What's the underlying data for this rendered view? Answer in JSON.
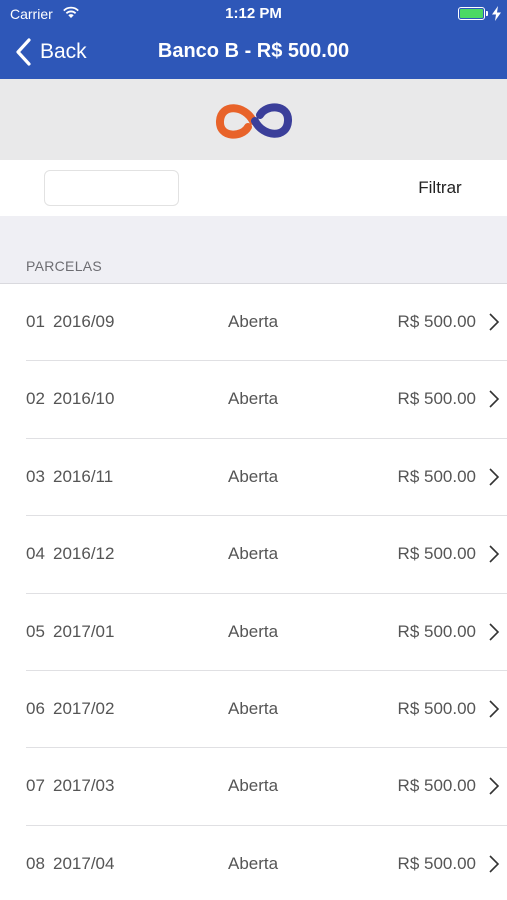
{
  "status_bar": {
    "carrier": "Carrier",
    "time": "1:12 PM",
    "battery_color": "#4cd964",
    "wifi_icon": "wifi-icon",
    "charging_icon": "bolt-icon"
  },
  "nav": {
    "back_label": "Back",
    "title": "Banco B - R$ 500.00",
    "bar_color": "#2e57b8"
  },
  "logo": {
    "icon": "infinity-logo",
    "colors": [
      "#e8632a",
      "#3b3f9a"
    ]
  },
  "filter": {
    "input_value": "",
    "button_label": "Filtrar"
  },
  "section": {
    "title": "PARCELAS"
  },
  "installments": [
    {
      "num": "01",
      "date": "2016/09",
      "status": "Aberta",
      "amount": "R$ 500.00"
    },
    {
      "num": "02",
      "date": "2016/10",
      "status": "Aberta",
      "amount": "R$ 500.00"
    },
    {
      "num": "03",
      "date": "2016/11",
      "status": "Aberta",
      "amount": "R$ 500.00"
    },
    {
      "num": "04",
      "date": "2016/12",
      "status": "Aberta",
      "amount": "R$ 500.00"
    },
    {
      "num": "05",
      "date": "2017/01",
      "status": "Aberta",
      "amount": "R$ 500.00"
    },
    {
      "num": "06",
      "date": "2017/02",
      "status": "Aberta",
      "amount": "R$ 500.00"
    },
    {
      "num": "07",
      "date": "2017/03",
      "status": "Aberta",
      "amount": "R$ 500.00"
    },
    {
      "num": "08",
      "date": "2017/04",
      "status": "Aberta",
      "amount": "R$ 500.00"
    }
  ]
}
